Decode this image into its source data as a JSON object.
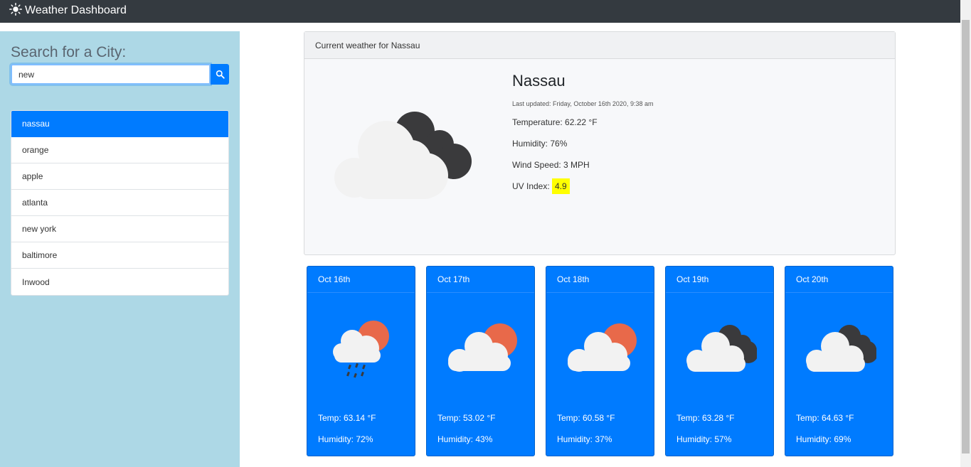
{
  "navbar": {
    "title": "Weather Dashboard"
  },
  "sidebar": {
    "heading": "Search for a City:",
    "search_value": "new",
    "cities": [
      "nassau",
      "orange",
      "apple",
      "atlanta",
      "new york",
      "baltimore",
      "Inwood"
    ],
    "active_city_index": 0
  },
  "current": {
    "header": "Current weather for Nassau",
    "city": "Nassau",
    "updated": "Last updated: Friday, October 16th 2020, 9:38 am",
    "temperature": "Temperature: 62.22 °F",
    "humidity": "Humidity: 76%",
    "wind": "Wind Speed: 3 MPH",
    "uv_label": "UV Index:",
    "uv_value": "4.9",
    "icon": "cloudy-dark-icon"
  },
  "forecast": [
    {
      "date": "Oct 16th",
      "icon": "rain-partly-sunny-icon",
      "temp": "Temp: 63.14 °F",
      "humidity": "Humidity: 72%"
    },
    {
      "date": "Oct 17th",
      "icon": "partly-sunny-icon",
      "temp": "Temp: 53.02 °F",
      "humidity": "Humidity: 43%"
    },
    {
      "date": "Oct 18th",
      "icon": "partly-sunny-icon",
      "temp": "Temp: 60.58 °F",
      "humidity": "Humidity: 37%"
    },
    {
      "date": "Oct 19th",
      "icon": "cloudy-dark-icon",
      "temp": "Temp: 63.28 °F",
      "humidity": "Humidity: 57%"
    },
    {
      "date": "Oct 20th",
      "icon": "cloudy-dark-icon",
      "temp": "Temp: 64.63 °F",
      "humidity": "Humidity: 69%"
    }
  ],
  "colors": {
    "navbar": "#343a40",
    "sidebar": "#add8e6",
    "primary": "#007bff",
    "uv_highlight": "#ffff00",
    "sun": "#e8694a",
    "dark_cloud": "#3a3a3c",
    "light_cloud": "#f2f2f2"
  }
}
